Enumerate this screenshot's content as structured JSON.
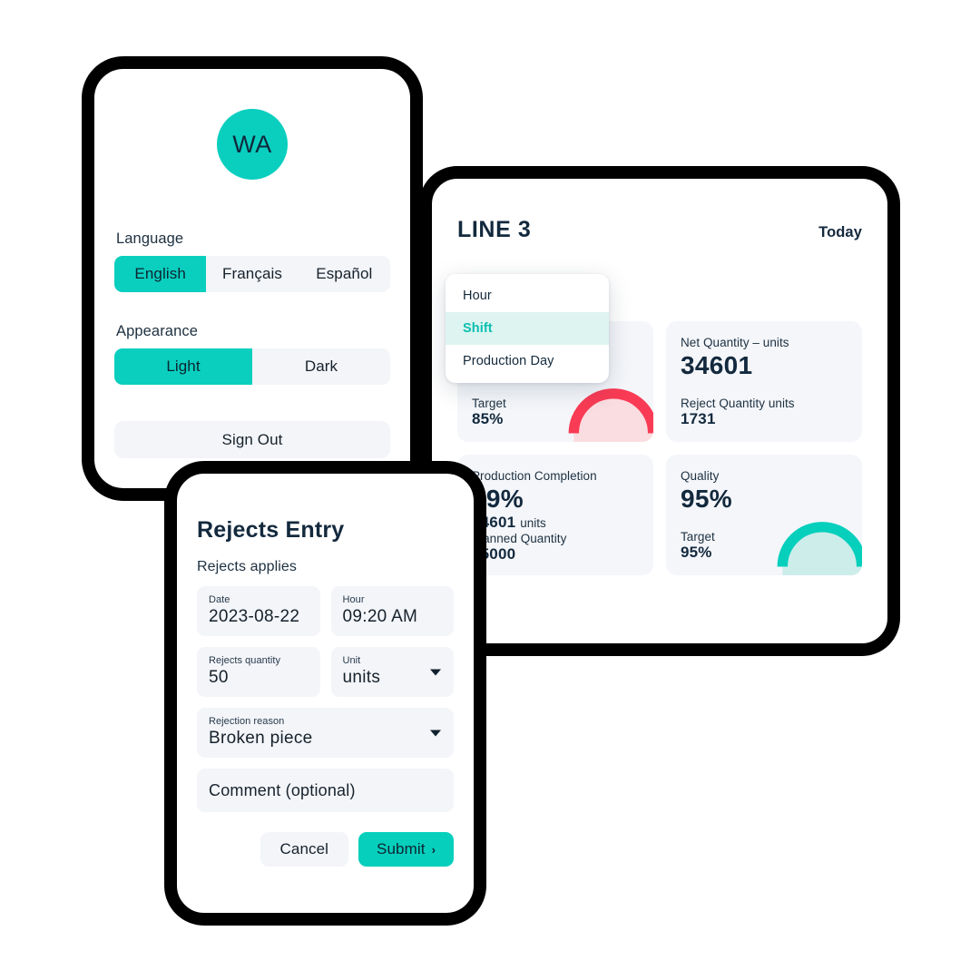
{
  "settings": {
    "avatar_initials": "WA",
    "language": {
      "label": "Language",
      "options": [
        "English",
        "Français",
        "Español"
      ],
      "selected": "English"
    },
    "appearance": {
      "label": "Appearance",
      "options": [
        "Light",
        "Dark"
      ],
      "selected": "Light"
    },
    "sign_out_label": "Sign Out"
  },
  "dashboard": {
    "title": "LINE 3",
    "date_range": "Today",
    "cards": [
      {
        "label": "",
        "value": "",
        "sub_label": "Target",
        "sub_value": "85%",
        "gauge": "red"
      },
      {
        "label": "Net Quantity – units",
        "value": "34601",
        "sub_label": "Reject Quantity units",
        "sub_value": "1731",
        "gauge": "none"
      },
      {
        "label": "Production Completion",
        "value": "99%",
        "units_value": "34601",
        "units_suffix": "units",
        "sub_label": "Planned Quantity",
        "sub_value": "35000",
        "gauge": "none"
      },
      {
        "label": "Quality",
        "value": "95%",
        "sub_label": "Target",
        "sub_value": "95%",
        "gauge": "teal"
      }
    ]
  },
  "period_dropdown": {
    "items": [
      "Hour",
      "Shift",
      "Production Day"
    ],
    "selected": "Shift"
  },
  "rejects_form": {
    "title": "Rejects Entry",
    "subtitle": "Rejects applies",
    "fields": {
      "date": {
        "label": "Date",
        "value": "2023-08-22"
      },
      "hour": {
        "label": "Hour",
        "value": "09:20 AM"
      },
      "quantity": {
        "label": "Rejects quantity",
        "value": "50"
      },
      "unit": {
        "label": "Unit",
        "value": "units"
      },
      "reason": {
        "label": "Rejection reason",
        "value": "Broken piece"
      },
      "comment": {
        "placeholder": "Comment (optional)",
        "value": "Comment (optional)"
      }
    },
    "cancel_label": "Cancel",
    "submit_label": "Submit",
    "submit_chevron": "›"
  },
  "colors": {
    "accent_teal": "#0ACFBF",
    "accent_teal_soft": "#ddf4f1",
    "gauge_red": "#F93B55",
    "gauge_red_soft": "#FADDE1",
    "gauge_teal": "#06CFBC",
    "gauge_teal_soft": "#CDEDEB",
    "card_bg": "#f4f6fa",
    "text_dark": "#13293d",
    "panel_border": "#000000"
  }
}
